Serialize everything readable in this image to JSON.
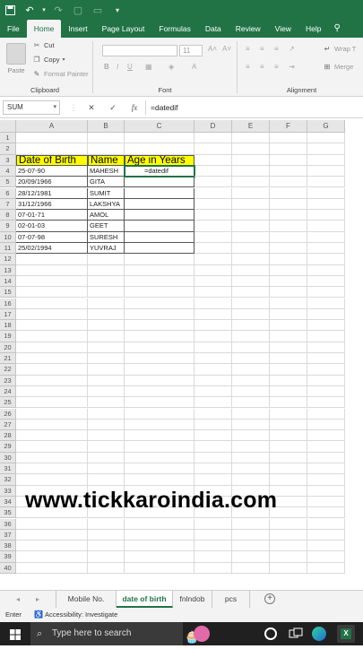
{
  "quick_access": {
    "icons": [
      "save-icon",
      "undo-icon",
      "redo-icon",
      "new-file-icon",
      "open-file-icon",
      "more-icon"
    ]
  },
  "tabs": [
    "File",
    "Home",
    "Insert",
    "Page Layout",
    "Formulas",
    "Data",
    "Review",
    "View",
    "Help"
  ],
  "active_tab": "Home",
  "ribbon": {
    "paste_label": "Paste",
    "cut_label": "Cut",
    "copy_label": "Copy",
    "format_painter_label": "Format Painter",
    "clipboard_group": "Clipboard",
    "font_group": "Font",
    "font_size": "11",
    "wrap_text_label": "Wrap T",
    "merge_label": "Merge",
    "alignment_group": "Alignment"
  },
  "formula_bar": {
    "name_box": "SUM",
    "cancel": "✕",
    "enter": "✓",
    "fx": "fx",
    "formula": "=datedif"
  },
  "columns": [
    "A",
    "B",
    "C",
    "D",
    "E",
    "F",
    "G"
  ],
  "rows": [
    "1",
    "2",
    "3",
    "4",
    "5",
    "6",
    "7",
    "8",
    "9",
    "10",
    "11",
    "12",
    "13",
    "14",
    "15",
    "16",
    "17",
    "18",
    "19",
    "20",
    "21",
    "22",
    "23",
    "24",
    "25",
    "26",
    "27",
    "28",
    "29",
    "30",
    "31",
    "32",
    "33",
    "34",
    "35",
    "36",
    "37",
    "38",
    "39",
    "40"
  ],
  "table": {
    "headers": [
      "Date of Birth",
      "Name",
      "Age in Years"
    ],
    "rows": [
      [
        "25-07-90",
        "MAHESH",
        "=datedif"
      ],
      [
        "20/09/1966",
        "GITA",
        ""
      ],
      [
        "28/12/1981",
        "SUMIT",
        ""
      ],
      [
        "31/12/1966",
        "LAKSHYA",
        ""
      ],
      [
        "07-01-71",
        "AMOL",
        ""
      ],
      [
        "02-01-03",
        "GEET",
        ""
      ],
      [
        "07-07-98",
        "SURESH",
        ""
      ],
      [
        "25/02/1994",
        "YUVRAJ",
        ""
      ]
    ]
  },
  "watermark": "www.tickkaroindia.com",
  "sheets": [
    "Mobile No.",
    "date of birth",
    "fnlndob",
    "pcs"
  ],
  "active_sheet": "date of birth",
  "status": {
    "mode": "Enter",
    "accessibility": "Accessibility: Investigate"
  },
  "taskbar": {
    "search_placeholder": "Type here to search"
  }
}
